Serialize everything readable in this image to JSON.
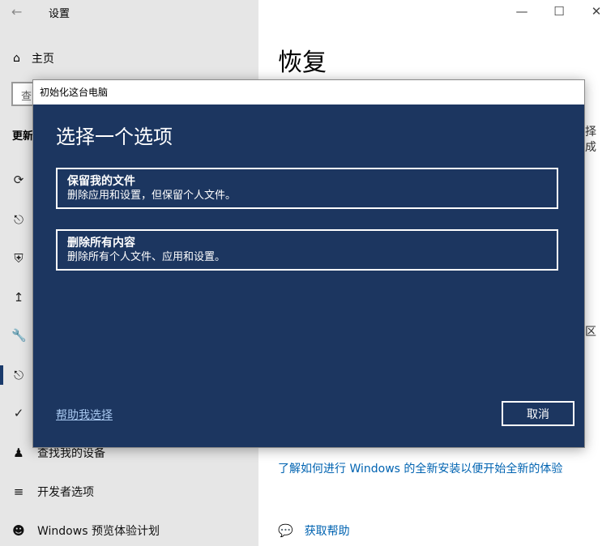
{
  "window": {
    "app_title": "设置",
    "back_icon": "arrow-left-icon",
    "controls": {
      "minimize": "—",
      "maximize": "☐",
      "close": "✕"
    }
  },
  "sidebar": {
    "home_label": "主页",
    "search_placeholder": "查",
    "section_label": "更新",
    "items": [
      {
        "icon": "sync-icon",
        "label": ""
      },
      {
        "icon": "delivery-icon",
        "label": ""
      },
      {
        "icon": "shield-icon",
        "label": ""
      },
      {
        "icon": "upload-arrow-icon",
        "label": ""
      },
      {
        "icon": "wrench-icon",
        "label": ""
      },
      {
        "icon": "recovery-icon",
        "label": ""
      },
      {
        "icon": "check-circle-icon",
        "label": ""
      },
      {
        "icon": "person-pin-icon",
        "label": "查找我的设备"
      },
      {
        "icon": "developer-icon",
        "label": "开发者选项"
      },
      {
        "icon": "insider-icon",
        "label": "Windows 预览体验计划"
      }
    ]
  },
  "main": {
    "title": "恢复",
    "fragments": [
      "择",
      "成",
      "区"
    ],
    "learn_link": "了解如何进行 Windows 的全新安装以便开始全新的体验",
    "get_help": "获取帮助"
  },
  "dialog": {
    "title": "初始化这台电脑",
    "heading": "选择一个选项",
    "options": [
      {
        "title": "保留我的文件",
        "desc": "删除应用和设置，但保留个人文件。"
      },
      {
        "title": "删除所有内容",
        "desc": "删除所有个人文件、应用和设置。"
      }
    ],
    "help_link": "帮助我选择",
    "cancel": "取消"
  },
  "colors": {
    "dialog_bg": "#1c3660",
    "sidebar_bg": "#e6e6e6",
    "link": "#0063b1",
    "help_link": "#a8c8f0"
  }
}
